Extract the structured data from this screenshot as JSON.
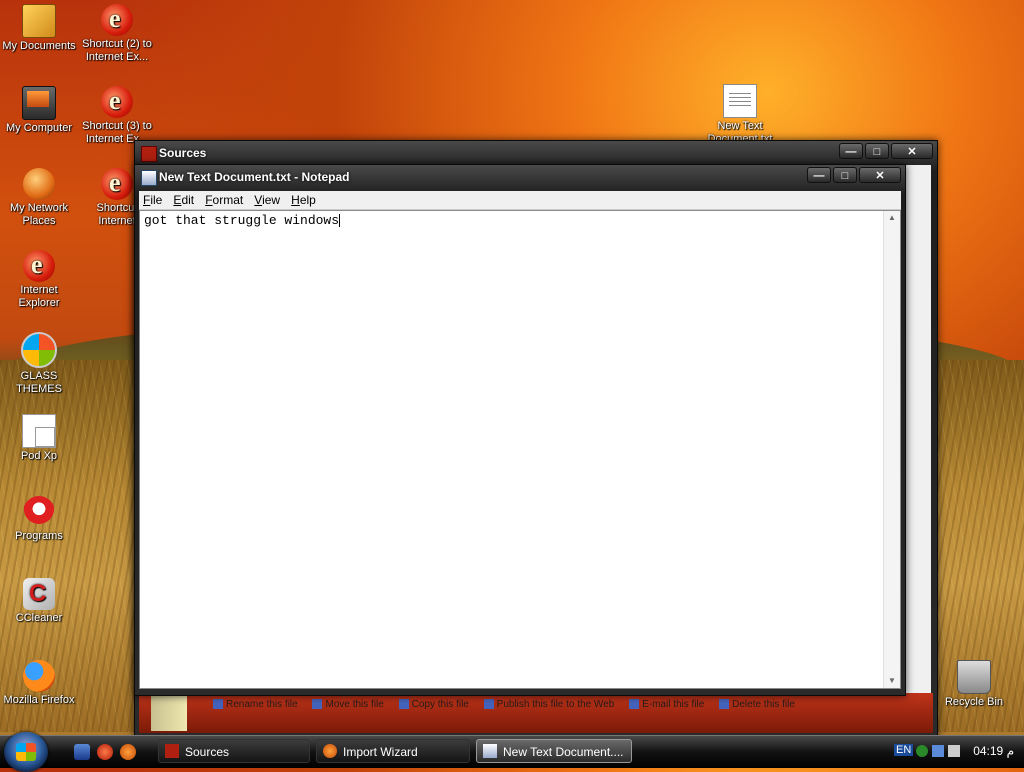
{
  "desktop": {
    "icons": [
      {
        "label": "My Documents"
      },
      {
        "label": "Shortcut (2) to Internet Ex..."
      },
      {
        "label": "My Computer"
      },
      {
        "label": "Shortcut (3) to Internet Ex..."
      },
      {
        "label": "My Network Places"
      },
      {
        "label": "Shortcut Internet"
      },
      {
        "label": "Internet Explorer"
      },
      {
        "label": "GLASS THEMES"
      },
      {
        "label": "Pod Xp"
      },
      {
        "label": "Programs"
      },
      {
        "label": "CCleaner"
      },
      {
        "label": "Mozilla Firefox"
      },
      {
        "label": "New Text Document.txt"
      },
      {
        "label": "Recycle Bin"
      }
    ]
  },
  "sources_window": {
    "title": "Sources",
    "task_links": [
      "Rename this file",
      "Move this file",
      "Copy this file",
      "Publish this file to the Web",
      "E-mail this file",
      "Delete this file"
    ]
  },
  "notepad": {
    "title": "New Text Document.txt - Notepad",
    "menu": [
      "File",
      "Edit",
      "Format",
      "View",
      "Help"
    ],
    "content": "got that struggle windows"
  },
  "taskbar": {
    "buttons": [
      {
        "label": "Sources"
      },
      {
        "label": "Import Wizard"
      },
      {
        "label": "New Text Document...."
      }
    ],
    "language": "EN",
    "clock": "04:19 م"
  },
  "colors": {
    "accent": "#c2430a",
    "taskbar": "#121212"
  }
}
